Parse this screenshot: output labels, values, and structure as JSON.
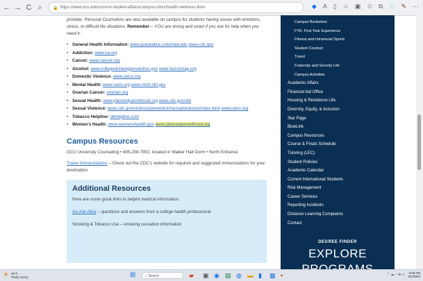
{
  "browser": {
    "url": "https://www.ocu.edu/current-student-affairs/campus-clinic/health-wellness-links",
    "nav_back": "←",
    "nav_forward": "→",
    "nav_reload": "C",
    "nav_search": "⌕",
    "lock": "🔒"
  },
  "main": {
    "intro_text": "provider. Personal Counselors are also available on campus for students having issues with emotions, stress, or difficult life situations.",
    "remember_label": "Remember",
    "remember_text": " – YOU are strong and smart if you ask for help when you need it.",
    "resources": [
      {
        "label": "General Health Information:",
        "links": [
          "www.goaskalice.columbia.edu",
          "www.cdc.gov"
        ]
      },
      {
        "label": "Addiction:",
        "links": [
          "www.na.org"
        ]
      },
      {
        "label": "Cancer:",
        "links": [
          "www.cancer.org"
        ]
      },
      {
        "label": "Alcohol:",
        "links": [
          "www.collegedrinkingprevention.gov",
          "www.factsontap.org"
        ]
      },
      {
        "label": "Domestic Violence:",
        "links": [
          "www.ywca.org"
        ]
      },
      {
        "label": "Mental Health:",
        "links": [
          "www.nami.org",
          "www.nimh.nih.gov"
        ]
      },
      {
        "label": "Ovarian Cancer:",
        "links": [
          "ovarian.org"
        ]
      },
      {
        "label": "Sexual Health:",
        "links": [
          "www.plannedparenthood.org",
          "www.cdc.gov/std"
        ]
      },
      {
        "label": "Sexual Violence:",
        "links": [
          "www.cdc.gov/violenceprevention/sexualviolence/index.html",
          "www.rainn.org"
        ]
      },
      {
        "label": "Tobacco Helpline:",
        "links": [
          "okhelpline.com"
        ]
      },
      {
        "label": "Women's Health:",
        "links": [
          "www.womenshealth.gov",
          "www.plannedparenthood.org"
        ]
      }
    ],
    "campus_heading": "Campus Resources",
    "counseling_text": "OCU University Counseling • 405-208-7902, located in Walker Hall Dorm • North Entrance",
    "travel_link": "Travel Immunizations",
    "travel_text": " – Check out the CDC's website for required and suggested immunizations for your destination.",
    "additional_heading": "Additional Resources",
    "additional_intro": "Here are some great links to helpful medical information.",
    "ask_alice_link": "Go Ask Alice",
    "ask_alice_text": "– questions and answers from a college health professional.",
    "cutoff_text": "Smoking & Tobacco Use – smoking cessation information"
  },
  "sidebar": {
    "items": [
      {
        "label": "Campus Bookstore",
        "sub": true
      },
      {
        "label": "FYE: First Year Experience",
        "sub": true
      },
      {
        "label": "Fitness and Intramural Sports",
        "sub": true
      },
      {
        "label": "Student Conduct",
        "sub": true
      },
      {
        "label": "Travel",
        "sub": true
      },
      {
        "label": "Fraternity and Sorority Life",
        "sub": true
      },
      {
        "label": "Campus Activities",
        "sub": true
      },
      {
        "label": "Academic Affairs",
        "sub": false
      },
      {
        "label": "Financial Aid Office",
        "sub": false
      },
      {
        "label": "Housing & Residence Life",
        "sub": false
      },
      {
        "label": "Diversity, Equity, & Inclusion",
        "sub": false
      },
      {
        "label": "Star Page",
        "sub": false
      },
      {
        "label": "BlueLink",
        "sub": false
      },
      {
        "label": "Campus Resources",
        "sub": false
      },
      {
        "label": "Course & Finals Schedule",
        "sub": false
      },
      {
        "label": "Tutoring (LEC)",
        "sub": false
      },
      {
        "label": "Student Policies",
        "sub": false
      },
      {
        "label": "Academic Calendar",
        "sub": false
      },
      {
        "label": "Current International Students",
        "sub": false
      },
      {
        "label": "Risk Management",
        "sub": false
      },
      {
        "label": "Career Services",
        "sub": false
      },
      {
        "label": "Reporting Incidents",
        "sub": false
      },
      {
        "label": "Distance Learning Complaints",
        "sub": false
      },
      {
        "label": "Contact",
        "sub": false
      }
    ],
    "degree_finder": "DEGREE FINDER",
    "explore": "EXPLORE",
    "programs": "PROGRAMS"
  },
  "taskbar": {
    "weather_temp": "38°F",
    "weather_desc": "Partly sunny",
    "search_placeholder": "Search",
    "time": "3:26 AM",
    "date": "2/1/2024"
  },
  "colors": {
    "sidebar_bg": "#0b2f53",
    "heading_blue": "#1f5b9c",
    "link_blue": "#2f6ebc",
    "highlight": "#fbf17a",
    "additional_box": "#d6ecf9"
  }
}
